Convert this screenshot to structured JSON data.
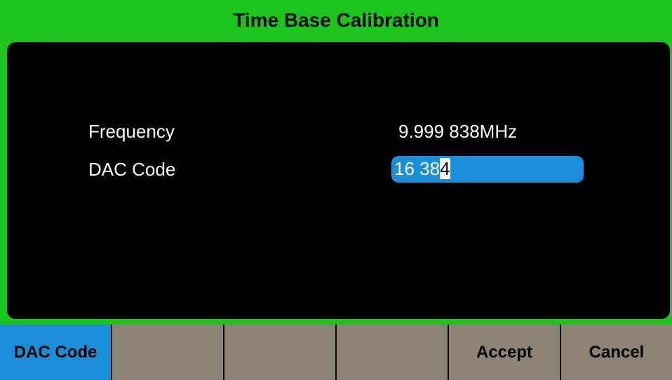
{
  "title": "Time Base Calibration",
  "fields": {
    "frequency_label": "Frequency",
    "frequency_value": "9.999 838MHz",
    "dac_label": "DAC Code",
    "dac_value_prefix": "16 38",
    "dac_value_cursor": "4"
  },
  "softkeys": [
    {
      "label": "DAC Code",
      "active": true
    },
    {
      "label": "",
      "active": false
    },
    {
      "label": "",
      "active": false
    },
    {
      "label": "",
      "active": false
    },
    {
      "label": "Accept",
      "active": false
    },
    {
      "label": "Cancel",
      "active": false
    }
  ],
  "colors": {
    "frame": "#1ec41e",
    "active_key": "#1a8fd8",
    "softkey": "#8c8373",
    "screen": "#000000"
  }
}
